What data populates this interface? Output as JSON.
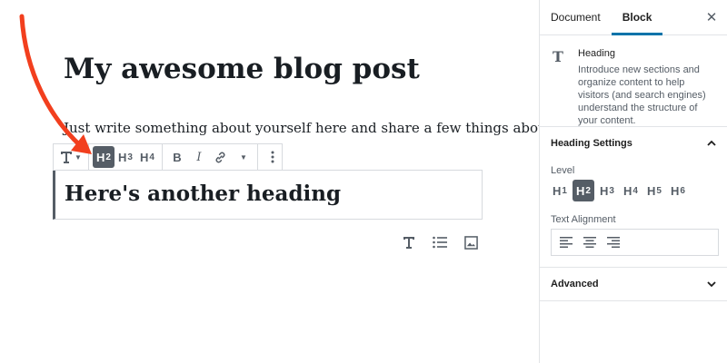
{
  "editor": {
    "post_title": "My awesome blog post",
    "paragraph": "Just write something about yourself here and share a few things about why",
    "heading_text": "Here's another heading",
    "toolbar": {
      "block_type_icon": "paragraph-T-icon",
      "levels": [
        {
          "letter": "H",
          "num": "2",
          "active": true
        },
        {
          "letter": "H",
          "num": "3",
          "active": false
        },
        {
          "letter": "H",
          "num": "4",
          "active": false
        }
      ],
      "bold_label": "B",
      "italic_label": "I",
      "link_icon": "link-icon",
      "more_icon": "more-vertical-icon"
    },
    "inserters": [
      "paragraph-icon",
      "list-icon",
      "image-icon"
    ],
    "annotation_arrow_color": "#f23f1e"
  },
  "sidebar": {
    "tabs": [
      {
        "label": "Document",
        "active": false
      },
      {
        "label": "Block",
        "active": true
      }
    ],
    "close_label": "✕",
    "block_card": {
      "icon": "T",
      "title": "Heading",
      "description": "Introduce new sections and organize content to help visitors (and search engines) understand the structure of your content."
    },
    "heading_settings": {
      "title": "Heading Settings",
      "level_label": "Level",
      "levels": [
        {
          "letter": "H",
          "num": "1",
          "active": false
        },
        {
          "letter": "H",
          "num": "2",
          "active": true
        },
        {
          "letter": "H",
          "num": "3",
          "active": false
        },
        {
          "letter": "H",
          "num": "4",
          "active": false
        },
        {
          "letter": "H",
          "num": "5",
          "active": false
        },
        {
          "letter": "H",
          "num": "6",
          "active": false
        }
      ],
      "alignment_label": "Text Alignment",
      "alignments": [
        "align-left-icon",
        "align-center-icon",
        "align-right-icon"
      ]
    },
    "advanced_title": "Advanced"
  },
  "colors": {
    "accent": "#0073aa",
    "active_button": "#555d66",
    "text": "#191e23"
  }
}
